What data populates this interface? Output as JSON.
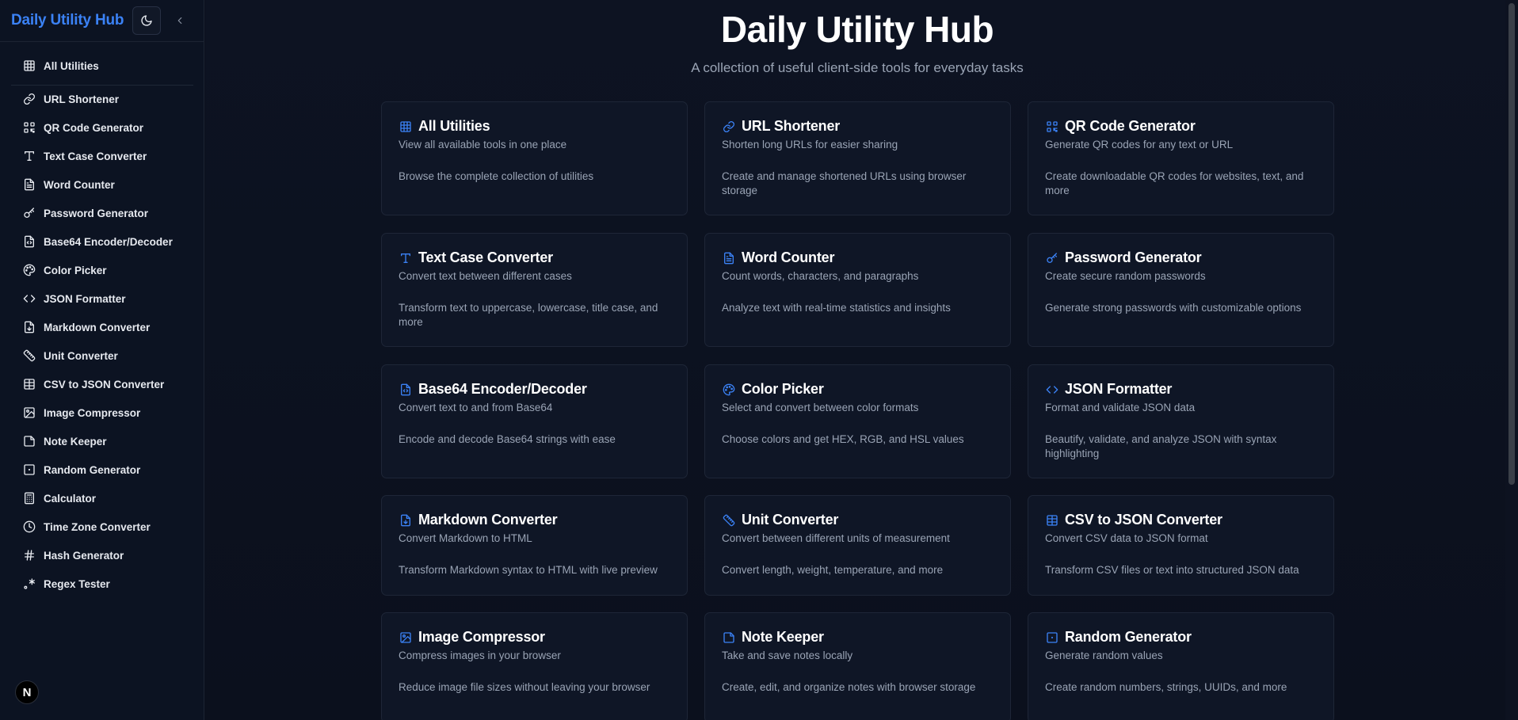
{
  "sidebar": {
    "title": "Daily Utility Hub",
    "items": [
      {
        "label": "All Utilities",
        "icon": "grid-icon"
      },
      {
        "label": "URL Shortener",
        "icon": "link-icon"
      },
      {
        "label": "QR Code Generator",
        "icon": "qr-code-icon"
      },
      {
        "label": "Text Case Converter",
        "icon": "type-icon"
      },
      {
        "label": "Word Counter",
        "icon": "document-icon"
      },
      {
        "label": "Password Generator",
        "icon": "key-icon"
      },
      {
        "label": "Base64 Encoder/Decoder",
        "icon": "file-code-icon"
      },
      {
        "label": "Color Picker",
        "icon": "palette-icon"
      },
      {
        "label": "JSON Formatter",
        "icon": "code-icon"
      },
      {
        "label": "Markdown Converter",
        "icon": "file-markdown-icon"
      },
      {
        "label": "Unit Converter",
        "icon": "ruler-icon"
      },
      {
        "label": "CSV to JSON Converter",
        "icon": "table-icon"
      },
      {
        "label": "Image Compressor",
        "icon": "image-icon"
      },
      {
        "label": "Note Keeper",
        "icon": "sticky-note-icon"
      },
      {
        "label": "Random Generator",
        "icon": "dice-icon"
      },
      {
        "label": "Calculator",
        "icon": "calculator-icon"
      },
      {
        "label": "Time Zone Converter",
        "icon": "clock-icon"
      },
      {
        "label": "Hash Generator",
        "icon": "hash-icon"
      },
      {
        "label": "Regex Tester",
        "icon": "regex-icon"
      }
    ],
    "badge": "N"
  },
  "main": {
    "title": "Daily Utility Hub",
    "subtitle": "A collection of useful client-side tools for everyday tasks",
    "cards": [
      {
        "title": "All Utilities",
        "subtitle": "View all available tools in one place",
        "description": "Browse the complete collection of utilities",
        "icon": "grid-icon"
      },
      {
        "title": "URL Shortener",
        "subtitle": "Shorten long URLs for easier sharing",
        "description": "Create and manage shortened URLs using browser storage",
        "icon": "link-icon"
      },
      {
        "title": "QR Code Generator",
        "subtitle": "Generate QR codes for any text or URL",
        "description": "Create downloadable QR codes for websites, text, and more",
        "icon": "qr-code-icon"
      },
      {
        "title": "Text Case Converter",
        "subtitle": "Convert text between different cases",
        "description": "Transform text to uppercase, lowercase, title case, and more",
        "icon": "type-icon"
      },
      {
        "title": "Word Counter",
        "subtitle": "Count words, characters, and paragraphs",
        "description": "Analyze text with real-time statistics and insights",
        "icon": "document-icon"
      },
      {
        "title": "Password Generator",
        "subtitle": "Create secure random passwords",
        "description": "Generate strong passwords with customizable options",
        "icon": "key-icon"
      },
      {
        "title": "Base64 Encoder/Decoder",
        "subtitle": "Convert text to and from Base64",
        "description": "Encode and decode Base64 strings with ease",
        "icon": "file-code-icon"
      },
      {
        "title": "Color Picker",
        "subtitle": "Select and convert between color formats",
        "description": "Choose colors and get HEX, RGB, and HSL values",
        "icon": "palette-icon"
      },
      {
        "title": "JSON Formatter",
        "subtitle": "Format and validate JSON data",
        "description": "Beautify, validate, and analyze JSON with syntax highlighting",
        "icon": "code-icon"
      },
      {
        "title": "Markdown Converter",
        "subtitle": "Convert Markdown to HTML",
        "description": "Transform Markdown syntax to HTML with live preview",
        "icon": "file-markdown-icon"
      },
      {
        "title": "Unit Converter",
        "subtitle": "Convert between different units of measurement",
        "description": "Convert length, weight, temperature, and more",
        "icon": "ruler-icon"
      },
      {
        "title": "CSV to JSON Converter",
        "subtitle": "Convert CSV data to JSON format",
        "description": "Transform CSV files or text into structured JSON data",
        "icon": "table-icon"
      },
      {
        "title": "Image Compressor",
        "subtitle": "Compress images in your browser",
        "description": "Reduce image file sizes without leaving your browser",
        "icon": "image-icon"
      },
      {
        "title": "Note Keeper",
        "subtitle": "Take and save notes locally",
        "description": "Create, edit, and organize notes with browser storage",
        "icon": "sticky-note-icon"
      },
      {
        "title": "Random Generator",
        "subtitle": "Generate random values",
        "description": "Create random numbers, strings, UUIDs, and more",
        "icon": "dice-icon"
      }
    ]
  },
  "colors": {
    "accent": "#3b82f6",
    "background": "#0b101d",
    "card": "#0f1626",
    "muted_text": "#9aa4b5"
  }
}
